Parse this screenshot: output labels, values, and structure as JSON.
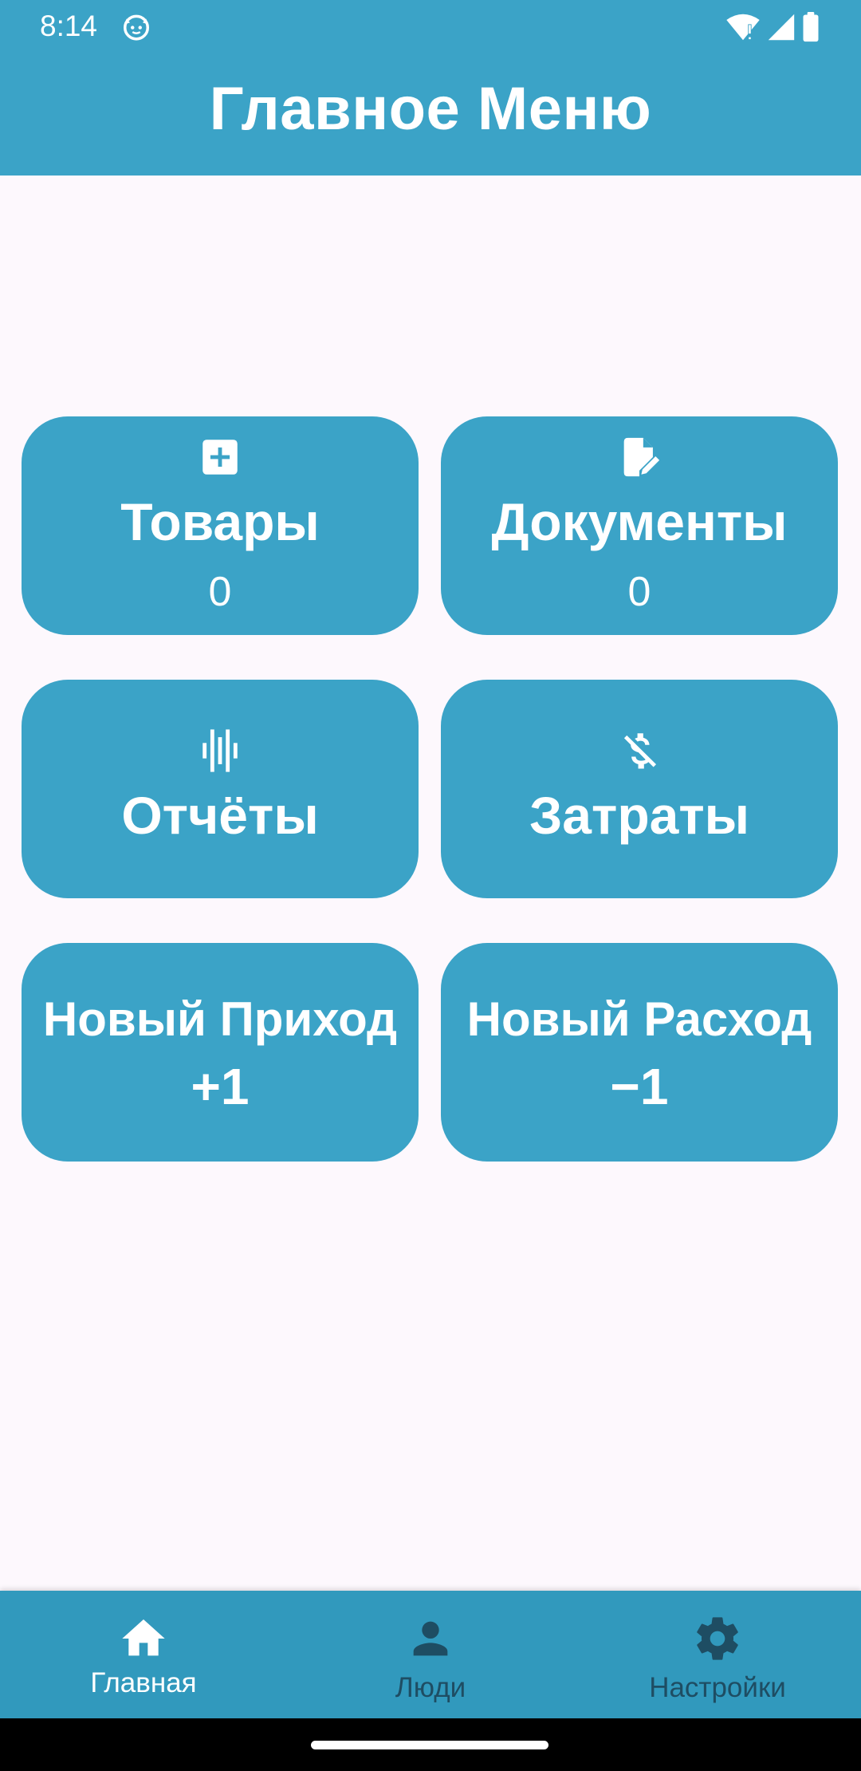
{
  "status_bar": {
    "time": "8:14",
    "app_icon": "cat-face-icon",
    "wifi_icon": "wifi-alert-icon",
    "signal_icon": "cell-signal-icon",
    "battery_icon": "battery-icon"
  },
  "header": {
    "title": "Главное Меню"
  },
  "colors": {
    "primary": "#3ba3c7",
    "nav_background": "#3199bd",
    "background": "#fdf8fd",
    "inactive_nav": "#1e4d63",
    "text_on_primary": "#ffffff"
  },
  "tiles": {
    "goods": {
      "label": "Товары",
      "value": "0",
      "icon": "add-box-icon"
    },
    "documents": {
      "label": "Документы",
      "value": "0",
      "icon": "edit-document-icon"
    },
    "reports": {
      "label": "Отчёты",
      "icon": "graphic-eq-icon"
    },
    "expenses": {
      "label": "Затраты",
      "icon": "money-off-icon"
    },
    "new_income": {
      "label": "Новый Приход",
      "value": "+1"
    },
    "new_expense": {
      "label": "Новый Расход",
      "value": "−1"
    }
  },
  "bottom_nav": {
    "items": [
      {
        "label": "Главная",
        "icon": "home-icon",
        "active": true
      },
      {
        "label": "Люди",
        "icon": "person-icon",
        "active": false
      },
      {
        "label": "Настройки",
        "icon": "gear-icon",
        "active": false
      }
    ]
  }
}
